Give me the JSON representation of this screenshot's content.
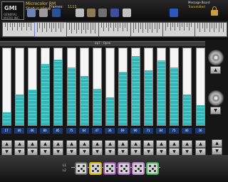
{
  "header": {
    "logo_text": "GMI",
    "logo_sub": "GENERAL MICRO INC.",
    "title_line1": "Microcolor RM",
    "title_line2": "Status View",
    "frames_label": "Frames:",
    "frames_value": "1111",
    "message_title": "Message Board",
    "message_value": "Transmitted",
    "toolbar_icons": [
      "folder-icon",
      "print-icon",
      "save-icon",
      "search-icon",
      "tool-icon",
      "settings-icon",
      "help-icon",
      "network-icon",
      "display-icon"
    ]
  },
  "section": {
    "title": "Up7 - Open"
  },
  "columns": [
    {
      "value": "17",
      "level": 0.17
    },
    {
      "value": "40",
      "level": 0.4
    },
    {
      "value": "46",
      "level": 0.46
    },
    {
      "value": "80",
      "level": 0.8
    },
    {
      "value": "85",
      "level": 0.85
    },
    {
      "value": "75",
      "level": 0.75
    },
    {
      "value": "64",
      "level": 0.64
    },
    {
      "value": "47",
      "level": 0.47
    },
    {
      "value": "36",
      "level": 0.36
    },
    {
      "value": "69",
      "level": 0.69
    },
    {
      "value": "90",
      "level": 0.9
    },
    {
      "value": "71",
      "level": 0.71
    },
    {
      "value": "84",
      "level": 0.84
    },
    {
      "value": "75",
      "level": 0.75
    },
    {
      "value": "40",
      "level": 0.4
    },
    {
      "value": "26",
      "level": 0.26
    }
  ],
  "bottom": {
    "labels": [
      "L1",
      "L2"
    ],
    "dice": 6
  },
  "colors": {
    "accent": "#e8c33a",
    "fill": "#35b6b6",
    "value_bg": "#193a78"
  }
}
